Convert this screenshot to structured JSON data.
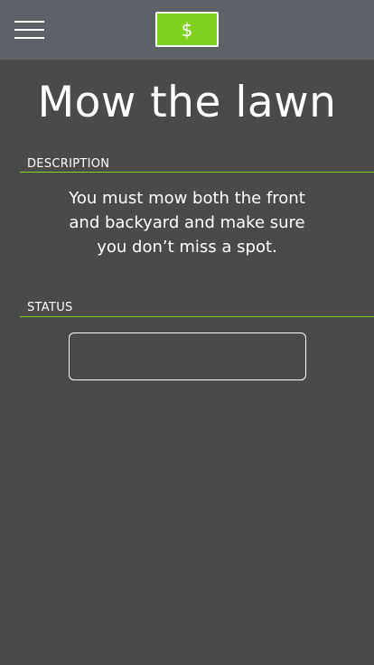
{
  "header": {
    "menu_icon": "hamburger-menu-icon",
    "money_button_label": "$"
  },
  "task": {
    "title": "Mow the lawn",
    "description_label": "DESCRIPTION",
    "description": "You must mow both the front and backyard and make sure you don’t miss a spot.",
    "status_label": "STATUS",
    "status_value": ""
  },
  "colors": {
    "accent": "#7ed321",
    "topbar": "#5d6269",
    "background": "#4a4a4a"
  }
}
